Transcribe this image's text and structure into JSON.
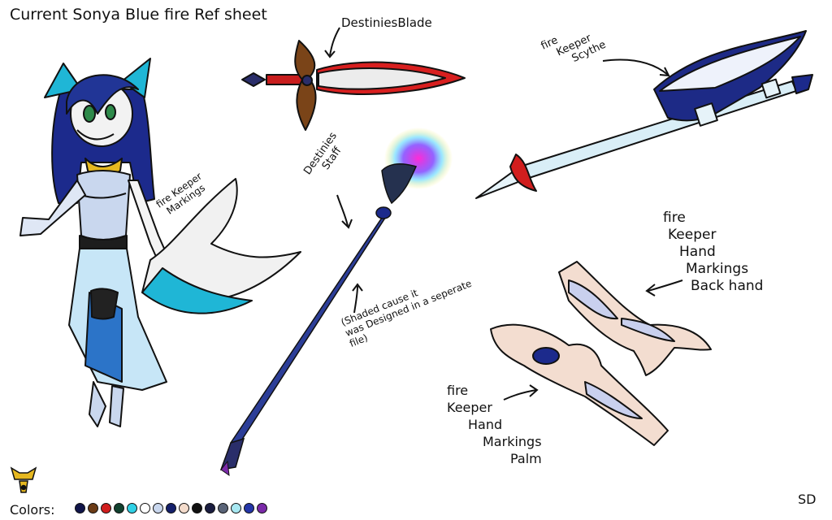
{
  "sheet": {
    "title": "Current Sonya Blue fire Ref sheet",
    "signature": "SD",
    "colors_label": "Colors:"
  },
  "labels": {
    "destinies_blade": "DestiniesBlade",
    "fire_keeper_scythe": [
      "fire",
      "Keeper",
      "Scythe"
    ],
    "destinies_staff": [
      "Destinies",
      "Staff"
    ],
    "fire_keeper_markings": [
      "fire Keeper",
      "Markings"
    ],
    "shaded_note": [
      "(Shaded cause it",
      "was Designed in a seperate",
      "file)"
    ],
    "hand_back": [
      "fire",
      "Keeper",
      "Hand",
      "Markings",
      "Back hand"
    ],
    "hand_palm": [
      "fire",
      "Keeper",
      "Hand",
      "Markings",
      "Palm"
    ]
  },
  "palette": [
    {
      "name": "black-blue",
      "hex": "#10154a"
    },
    {
      "name": "brown",
      "hex": "#6b3b16"
    },
    {
      "name": "red",
      "hex": "#d11e1e"
    },
    {
      "name": "dark-green",
      "hex": "#10402e"
    },
    {
      "name": "aqua",
      "hex": "#2fd1e6"
    },
    {
      "name": "white",
      "hex": "#ffffff"
    },
    {
      "name": "light-blue",
      "hex": "#c9d7ee"
    },
    {
      "name": "navy",
      "hex": "#14206b"
    },
    {
      "name": "peach",
      "hex": "#f4dccc"
    },
    {
      "name": "black",
      "hex": "#111111"
    },
    {
      "name": "dark-navy",
      "hex": "#1a1d40"
    },
    {
      "name": "slate",
      "hex": "#5a6478"
    },
    {
      "name": "cyan-white",
      "hex": "#a8e8f2"
    },
    {
      "name": "deep-blue",
      "hex": "#2436a8"
    },
    {
      "name": "violet",
      "hex": "#7a2aa8"
    }
  ]
}
